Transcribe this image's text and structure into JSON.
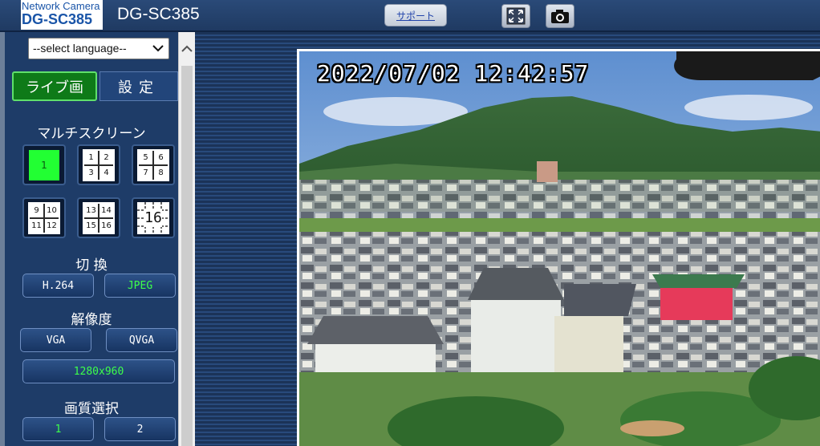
{
  "header": {
    "logo_line1": "Network Camera",
    "logo_line2": "DG-SC385",
    "model": "DG-SC385",
    "support_label": "サポート",
    "fullscreen_icon": "fullscreen-icon",
    "snapshot_icon": "camera-icon"
  },
  "sidebar": {
    "language_select": "--select language--",
    "tabs": {
      "live": "ライブ画",
      "settings": "設定"
    },
    "multiscreen_title": "マルチスクリーン",
    "multiscreen": {
      "single": "1",
      "quad": [
        "1",
        "2",
        "3",
        "4"
      ],
      "quad2": [
        "5",
        "6",
        "7",
        "8"
      ],
      "quad3": [
        "9",
        "10",
        "11",
        "12"
      ],
      "quad4": [
        "13",
        "14",
        "15",
        "16"
      ],
      "sixteen": "16"
    },
    "switch_title": "切 換",
    "codec": {
      "h264": "H.264",
      "jpeg": "JPEG"
    },
    "resolution_title": "解像度",
    "resolution": {
      "vga": "VGA",
      "qvga": "QVGA",
      "hd": "1280x960"
    },
    "quality_title": "画質選択",
    "quality": {
      "q1": "1",
      "q2": "2"
    }
  },
  "camera": {
    "timestamp": "2022/07/02 12:42:57"
  },
  "colors": {
    "active_green": "#3dff4a",
    "panel_bg": "#1e3c68"
  }
}
